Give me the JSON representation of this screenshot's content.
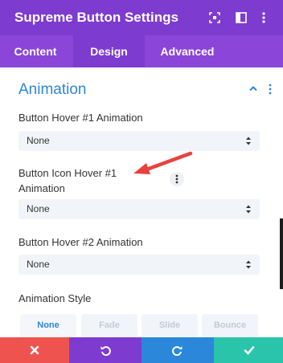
{
  "header": {
    "title": "Supreme Button Settings",
    "icons": [
      "focus-icon",
      "sidebar-icon",
      "more-vertical-icon"
    ]
  },
  "tabs": [
    {
      "label": "Content",
      "active": false
    },
    {
      "label": "Design",
      "active": true
    },
    {
      "label": "Advanced",
      "active": false
    }
  ],
  "section": {
    "title": "Animation",
    "expanded": true
  },
  "fields": {
    "hover1": {
      "label": "Button Hover #1 Animation",
      "value": "None"
    },
    "iconHover1": {
      "label_line1": "Button Icon Hover #1",
      "label_line2": "Animation",
      "value": "None"
    },
    "hover2": {
      "label": "Button Hover #2 Animation",
      "value": "None"
    }
  },
  "animation_style": {
    "label": "Animation Style",
    "options": [
      "None",
      "Fade",
      "Slide",
      "Bounce"
    ],
    "selected": "None"
  },
  "footer": {
    "buttons": [
      {
        "name": "close",
        "color": "#ef5350"
      },
      {
        "name": "undo",
        "color": "#7e3bd0"
      },
      {
        "name": "redo",
        "color": "#2b87da"
      },
      {
        "name": "save",
        "color": "#29c4a9"
      }
    ]
  },
  "colors": {
    "header": "#7d3bcf",
    "tabs": "#8b45d9",
    "accent": "#2b87da",
    "annotation_arrow": "#e8423f"
  }
}
